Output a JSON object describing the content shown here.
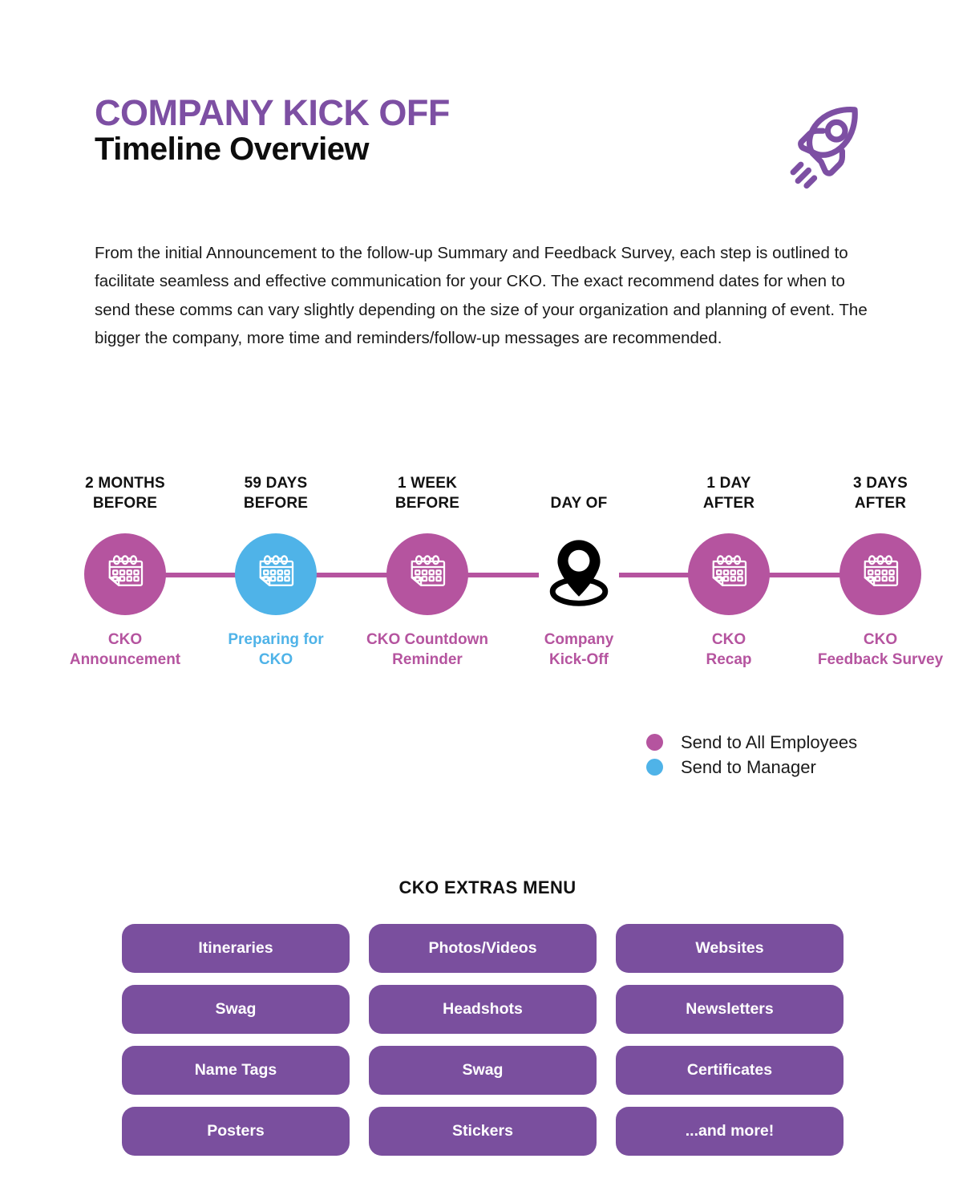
{
  "header": {
    "title_main": "COMPANY KICK OFF",
    "title_sub": "Timeline Overview",
    "rocket_icon": "rocket-icon",
    "title_color": "#7d4fa3"
  },
  "intro": {
    "paragraph": "From the initial Announcement to the follow-up Summary and Feedback Survey, each step is outlined to facilitate seamless and effective communication for your CKO. The exact recommend dates for when to send these comms can vary slightly depending on the size of your organization and planning of event. The bigger the company, more time and reminders/follow-up messages are recommended."
  },
  "timeline": {
    "line_color": "#b5549f",
    "nodes": [
      {
        "when": "2 MONTHS\nBEFORE",
        "label": "CKO\nAnnouncement",
        "icon": "calendar-icon",
        "audience": "all-employees",
        "color": "#b5549f"
      },
      {
        "when": "59 DAYS\nBEFORE",
        "label": "Preparing for\nCKO",
        "icon": "calendar-icon",
        "audience": "manager",
        "color": "#4fb3e8"
      },
      {
        "when": "1 WEEK\nBEFORE",
        "label": "CKO Countdown\nReminder",
        "icon": "calendar-icon",
        "audience": "all-employees",
        "color": "#b5549f"
      },
      {
        "when": "DAY OF",
        "label": "Company\nKick-Off",
        "icon": "location-pin-icon",
        "audience": "event",
        "color": "#000000"
      },
      {
        "when": "1 DAY\nAFTER",
        "label": "CKO\nRecap",
        "icon": "calendar-icon",
        "audience": "all-employees",
        "color": "#b5549f"
      },
      {
        "when": "3 DAYS\nAFTER",
        "label": "CKO\nFeedback Survey",
        "icon": "calendar-icon",
        "audience": "all-employees",
        "color": "#b5549f"
      }
    ]
  },
  "legend": {
    "items": [
      {
        "label": "Send to All Employees",
        "color": "#b5549f"
      },
      {
        "label": "Send to Manager",
        "color": "#4fb3e8"
      }
    ]
  },
  "extras": {
    "title": "CKO EXTRAS MENU",
    "button_color": "#7a4f9e",
    "rows": [
      [
        "Itineraries",
        "Photos/Videos",
        "Websites"
      ],
      [
        "Swag",
        "Headshots",
        "Newsletters"
      ],
      [
        "Name Tags",
        "Swag",
        "Certificates"
      ],
      [
        "Posters",
        "Stickers",
        "...and more!"
      ]
    ]
  }
}
